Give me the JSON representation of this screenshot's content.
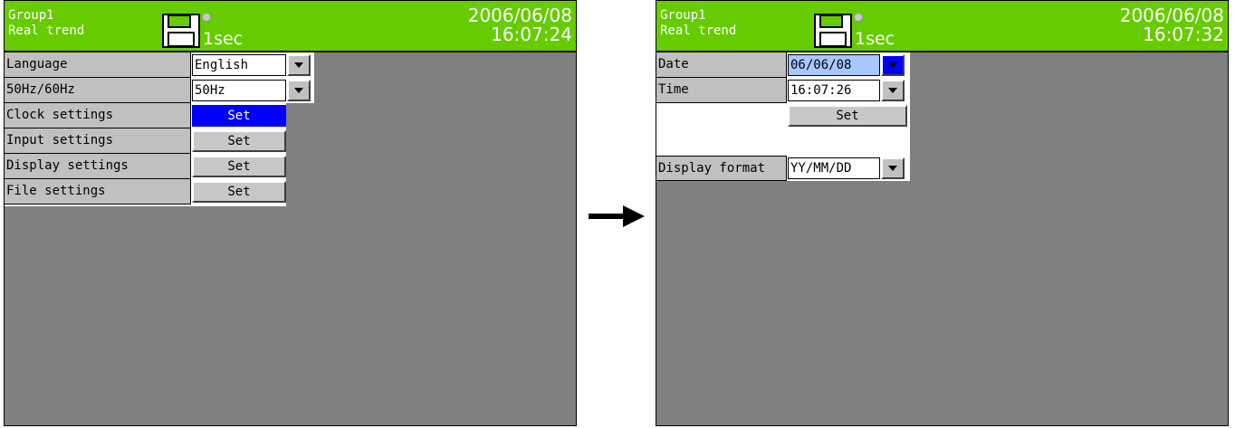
{
  "left_screen": {
    "header": {
      "group": "Group1",
      "mode": "Real trend",
      "interval": "1sec",
      "date": "2006/06/08",
      "time": "16:07:24",
      "storage_icon": "floppy-disk-icon"
    },
    "rows": [
      {
        "label": "Language",
        "value": "English"
      },
      {
        "label": "50Hz/60Hz",
        "value": "50Hz"
      },
      {
        "label": "Clock settings",
        "button": "Set",
        "selected": true
      },
      {
        "label": "Input settings",
        "button": "Set"
      },
      {
        "label": "Display settings",
        "button": "Set"
      },
      {
        "label": "File settings",
        "button": "Set"
      }
    ]
  },
  "right_screen": {
    "header": {
      "group": "Group1",
      "mode": "Real trend",
      "interval": "1sec",
      "date": "2006/06/08",
      "time": "16:07:32",
      "storage_icon": "floppy-disk-icon"
    },
    "date_label": "Date",
    "date_value": "06/06/08",
    "time_label": "Time",
    "time_value": "16:07:26",
    "set_button": "Set",
    "display_format_label": "Display format",
    "display_format_value": "YY/MM/DD"
  },
  "transition_icon": "right-arrow-icon",
  "colors": {
    "header_bg": "#66cc00",
    "screen_bg": "#808080",
    "selection": "#0000ff",
    "highlight_field": "#a6c8ff"
  }
}
